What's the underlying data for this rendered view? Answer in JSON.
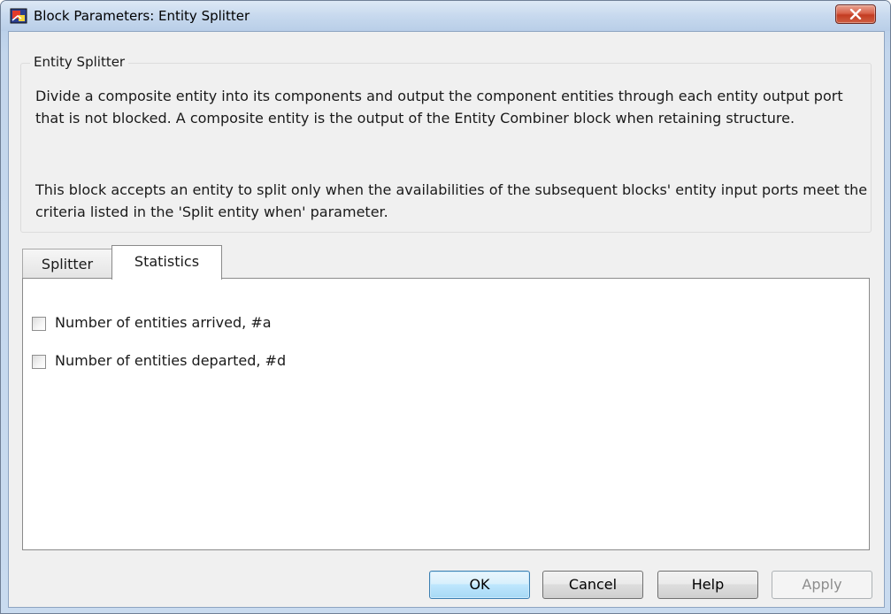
{
  "window": {
    "title": "Block Parameters: Entity Splitter",
    "icon": "simulink-block-icon"
  },
  "group": {
    "title": "Entity Splitter",
    "description_1": "Divide a composite entity into its components and output the component entities through each entity output port that is not blocked. A composite entity is the output of the Entity Combiner block when retaining structure.",
    "description_2": "This block accepts an entity to split only when the availabilities of the subsequent blocks' entity input ports meet the criteria listed in the 'Split entity when' parameter."
  },
  "tabs": [
    {
      "label": "Splitter",
      "selected": false
    },
    {
      "label": "Statistics",
      "selected": true
    }
  ],
  "statistics": {
    "options": [
      {
        "label": "Number of entities arrived, #a",
        "checked": false
      },
      {
        "label": "Number of entities departed, #d",
        "checked": false
      }
    ]
  },
  "buttons": {
    "ok": "OK",
    "cancel": "Cancel",
    "help": "Help",
    "apply": "Apply"
  },
  "colors": {
    "close_button": "#c94a32",
    "default_button_border": "#3c7fb1",
    "disabled_text": "#8d8d8d"
  }
}
